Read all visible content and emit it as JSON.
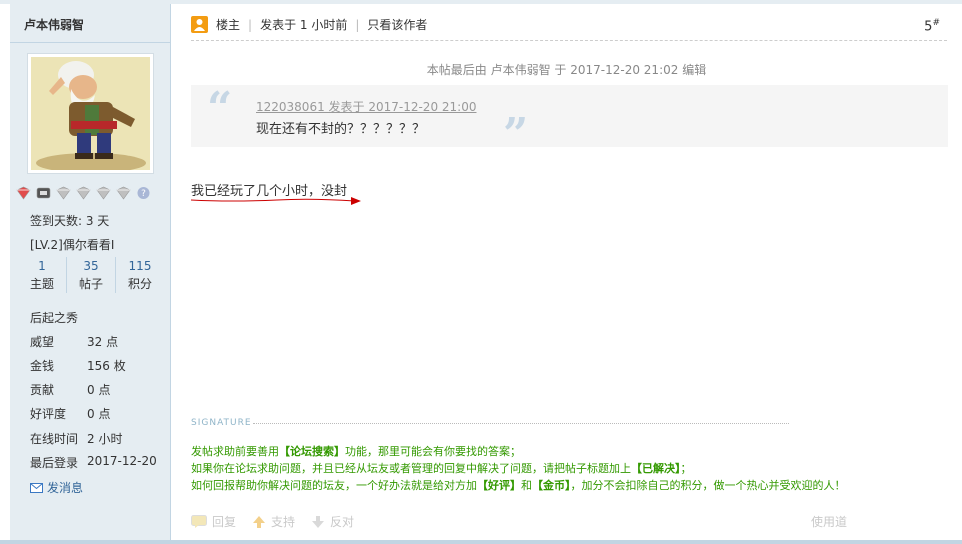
{
  "author": {
    "name": "卢本伟弱智",
    "sign_days": "签到天数: 3 天",
    "level": "[LV.2]偶尔看看I",
    "counts": [
      {
        "num": "1",
        "label": "主题"
      },
      {
        "num": "35",
        "label": "帖子"
      },
      {
        "num": "115",
        "label": "积分"
      }
    ],
    "rank": "后起之秀",
    "info": [
      {
        "label": "威望",
        "value": "32 点"
      },
      {
        "label": "金钱",
        "value": "156 枚"
      },
      {
        "label": "贡献",
        "value": "0 点"
      },
      {
        "label": "好评度",
        "value": "0 点"
      },
      {
        "label": "在线时间",
        "value": "2 小时"
      },
      {
        "label": "最后登录",
        "value": "2017-12-20"
      }
    ],
    "send_message": "发消息"
  },
  "post": {
    "owner_label": "楼主",
    "posted": "发表于 1 小时前",
    "only_author": "只看该作者",
    "floor_num": "5",
    "floor_mark": "#",
    "edit_note": "本帖最后由 卢本伟弱智 于 2017-12-20 21:02 编辑",
    "quote_author": "122038061 发表于 2017-12-20 21:00",
    "quote_text": "现在还有不封的？？？？？？",
    "body": "我已经玩了几个小时，没封"
  },
  "signature": {
    "label": "SIGNATURE",
    "line1_a": "发帖求助前要善用",
    "line1_b": "【论坛搜索】",
    "line1_c": "功能，那里可能会有你要找的答案；",
    "line2_a": "如果你在论坛求助问题，并且已经从坛友或者管理的回复中解决了问题，请把帖子标题加上",
    "line2_b": "【已解决】",
    "line2_c": "；",
    "line3_a": "如何回报帮助你解决问题的坛友，一个好办法就是给对方加",
    "line3_b": "【好评】",
    "line3_c": "和",
    "line3_d": "【金币】",
    "line3_e": "，加分不会扣除自己的积分，做一个热心并受欢迎的人！"
  },
  "actions": {
    "reply": "回复",
    "support": "支持",
    "oppose": "反对",
    "use_road": "使用道"
  },
  "colors": {
    "sidebar_bg": "#e5edf2",
    "link": "#336699",
    "signature_green": "#339900",
    "annotation_red": "#cc0000"
  }
}
